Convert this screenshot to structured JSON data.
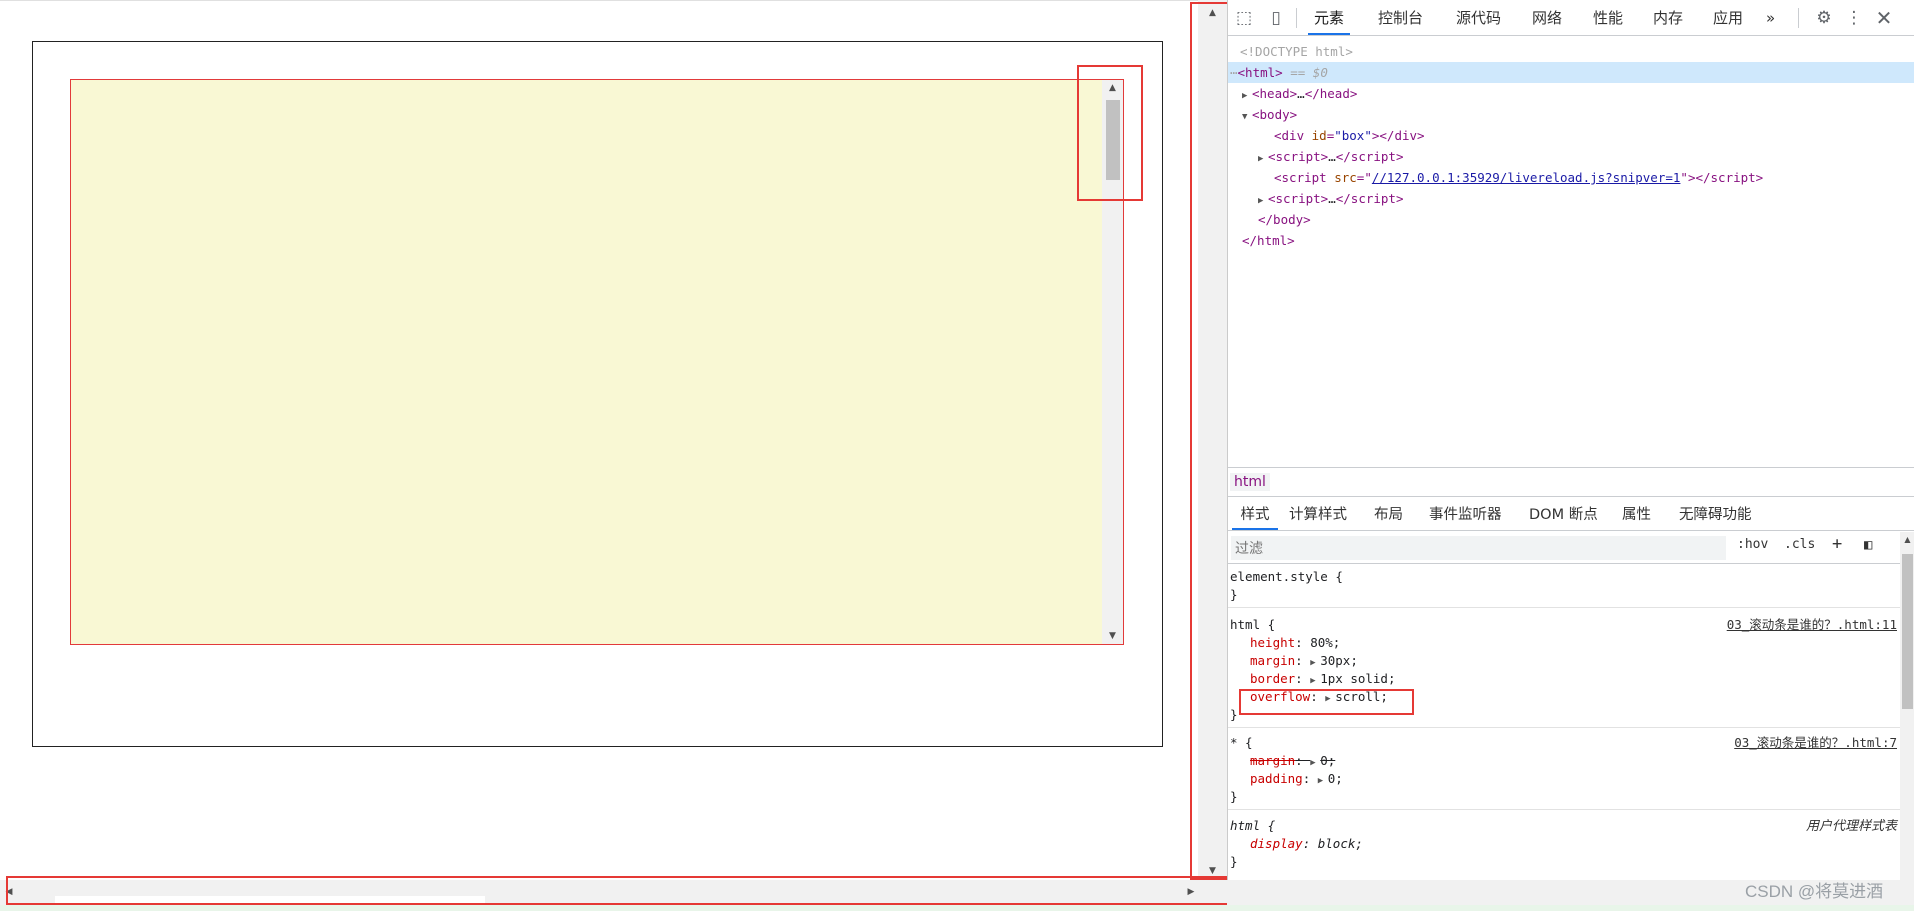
{
  "devtools": {
    "tabs": [
      "元素",
      "控制台",
      "源代码",
      "网络",
      "性能",
      "内存",
      "应用"
    ],
    "more_tabs": "»",
    "tree": {
      "doctype": "<!DOCTYPE html>",
      "html_open": "<html>",
      "html_eq": "== $0",
      "head": "…",
      "body_open": "<body>",
      "div_tag": "div",
      "div_attr": "id",
      "div_val": "\"box\"",
      "script_dots": "…",
      "script_src_attr": "src",
      "script_src_url": "//127.0.0.1:35929/livereload.js?snipver=1",
      "body_close": "</body>",
      "html_close": "</html>"
    },
    "breadcrumb": "html",
    "styles_tabs": [
      "样式",
      "计算样式",
      "布局",
      "事件监听器",
      "DOM 断点",
      "属性",
      "无障碍功能"
    ],
    "filter_placeholder": "过滤",
    "hov": ":hov",
    "cls": ".cls",
    "rules": {
      "element_style": "element.style {",
      "close": "}",
      "html_selector": "html {",
      "html_src": "03_滚动条是谁的？.html:11",
      "height_prop": "height",
      "height_val": "80%;",
      "margin_prop": "margin",
      "margin_val": "30px;",
      "border_prop": "border",
      "border_val": "1px solid;",
      "overflow_prop": "overflow",
      "overflow_val": "scroll;",
      "star_selector": "* {",
      "star_src": "03_滚动条是谁的？.html:7",
      "star_margin_prop": "margin",
      "star_margin_val": "0;",
      "padding_prop": "padding",
      "padding_val": "0;",
      "ua_selector": "html {",
      "ua_src": "用户代理样式表",
      "display_prop": "display",
      "display_val": "block;"
    }
  },
  "watermark": "CSDN @将莫进酒"
}
